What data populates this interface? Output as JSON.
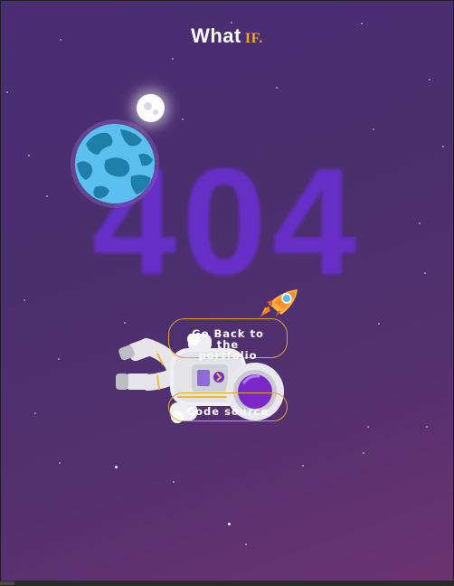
{
  "header": {
    "title": "What",
    "title_accent": "IF."
  },
  "error": {
    "code": "404"
  },
  "actions": {
    "back_label": "Go Back to the portfolio",
    "source_label": "Code source"
  },
  "colors": {
    "background_top": "#4a2d74",
    "background_bottom": "#6b3370",
    "accent": "#f5a623",
    "button_border": "#e2a431",
    "code_color": "#6a2fd0",
    "earth_blue": "#5bc0f0",
    "earth_land": "#1f7fa8"
  },
  "icons": {
    "earth": "earth-icon",
    "moon": "moon-icon",
    "rocket": "rocket-icon",
    "astronaut": "astronaut-icon"
  }
}
